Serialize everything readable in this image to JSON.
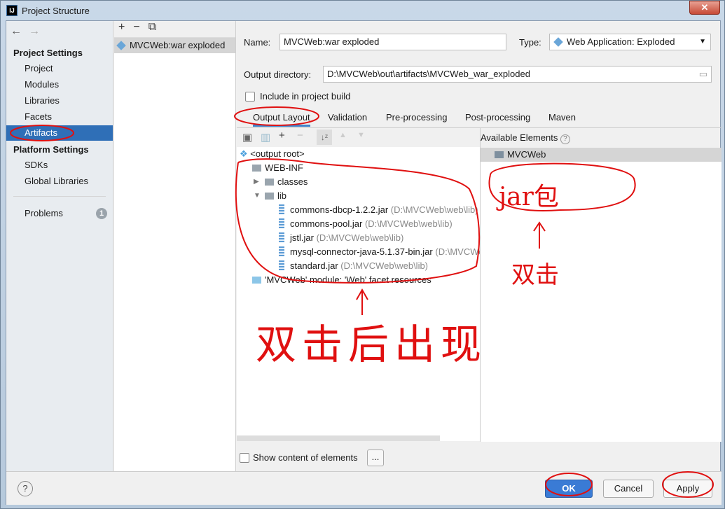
{
  "window": {
    "title": "Project Structure",
    "app_icon": "IJ",
    "close": "✕"
  },
  "sidebar": {
    "back": "←",
    "forward": "→",
    "project_settings": "Project Settings",
    "items": [
      "Project",
      "Modules",
      "Libraries",
      "Facets",
      "Artifacts"
    ],
    "platform_settings": "Platform Settings",
    "platform_items": [
      "SDKs",
      "Global Libraries"
    ],
    "problems": "Problems",
    "problems_count": "1",
    "selected": "Artifacts"
  },
  "artifacts": {
    "toolbar": [
      "+",
      "−",
      "⧉"
    ],
    "items": [
      "MVCWeb:war exploded"
    ]
  },
  "form": {
    "name_label": "Name:",
    "name_value": "MVCWeb:war exploded",
    "type_label": "Type:",
    "type_value": "Web Application: Exploded",
    "output_label": "Output directory:",
    "output_value": "D:\\MVCWeb\\out\\artifacts\\MVCWeb_war_exploded",
    "include_label": "Include in project build",
    "include_checked": false
  },
  "tabs": [
    "Output Layout",
    "Validation",
    "Pre-processing",
    "Post-processing",
    "Maven"
  ],
  "active_tab": "Output Layout",
  "tree": {
    "root": "<output root>",
    "webinf": "WEB-INF",
    "classes": "classes",
    "lib": "lib",
    "jars": [
      {
        "name": "commons-dbcp-1.2.2.jar",
        "path": "(D:\\MVCWeb\\web\\lib)"
      },
      {
        "name": "commons-pool.jar",
        "path": "(D:\\MVCWeb\\web\\lib)"
      },
      {
        "name": "jstl.jar",
        "path": "(D:\\MVCWeb\\web\\lib)"
      },
      {
        "name": "mysql-connector-java-5.1.37-bin.jar",
        "path": "(D:\\MVCWeb"
      },
      {
        "name": "standard.jar",
        "path": "(D:\\MVCWeb\\web\\lib)"
      }
    ],
    "facet": "'MVCWeb' module: 'Web' facet resources"
  },
  "available": {
    "title": "Available Elements",
    "help": "?",
    "items": [
      "MVCWeb"
    ]
  },
  "show_content_label": "Show content of elements",
  "ellipsis": "...",
  "footer": {
    "help": "?",
    "ok": "OK",
    "cancel": "Cancel",
    "apply": "Apply"
  },
  "annotations": {
    "jar": "jar包",
    "double_click": "双击",
    "appears": "双击后出现"
  },
  "colors": {
    "selection": "#2f6fb7",
    "annotation": "#e01010"
  }
}
